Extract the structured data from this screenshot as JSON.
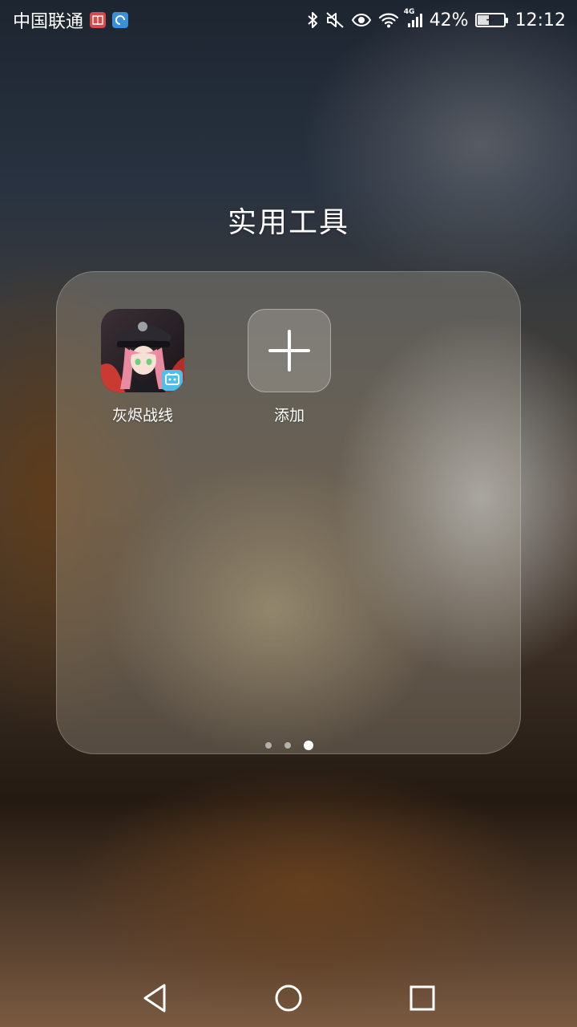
{
  "status_bar": {
    "carrier": "中国联通",
    "network": "4G",
    "battery": "42%",
    "battery_level": 0.42,
    "time": "12:12",
    "icons": [
      "book-app-icon",
      "browser-app-icon",
      "bluetooth-icon",
      "mute-icon",
      "eye-comfort-icon",
      "wifi-icon",
      "signal-icon",
      "battery-icon"
    ]
  },
  "folder": {
    "title": "实用工具",
    "apps": [
      {
        "label": "灰烬战线",
        "icon": "game-app-icon"
      },
      {
        "label": "添加",
        "icon": "add-icon"
      }
    ],
    "pages": {
      "total": 3,
      "current": 3
    }
  },
  "navigation": {
    "icons": [
      "back-icon",
      "home-icon",
      "recents-icon"
    ]
  },
  "colors": {
    "notif_book": "#d84a4a",
    "notif_browser": "#3a8fd9",
    "game_bg": "#2a2024",
    "game_accent": "#4cc0e8"
  }
}
